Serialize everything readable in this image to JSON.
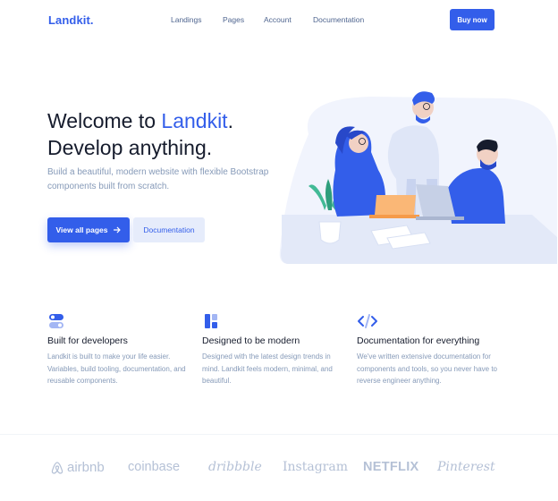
{
  "nav": {
    "logo": "Landkit.",
    "links": [
      "Landings",
      "Pages",
      "Account",
      "Documentation"
    ],
    "cta": "Buy now"
  },
  "hero": {
    "title_line1_prefix": "Welcome to ",
    "title_line1_accent": "Landkit",
    "title_line1_suffix": ".",
    "title_line2": "Develop anything.",
    "subtitle": "Build a beautiful, modern website with flexible Bootstrap components built from scratch.",
    "primary_button": "View all pages",
    "secondary_button": "Documentation"
  },
  "features": [
    {
      "icon": "toggle-icon",
      "title": "Built for developers",
      "text": "Landkit is built to make your life easier. Variables, build tooling, documentation, and reusable components."
    },
    {
      "icon": "layout-grid-icon",
      "title": "Designed to be modern",
      "text": "Designed with the latest design trends in mind. Landkit feels modern, minimal, and beautiful."
    },
    {
      "icon": "code-icon",
      "title": "Documentation for everything",
      "text": "We've written extensive documentation for components and tools, so you never have to reverse engineer anything."
    }
  ],
  "brands": [
    "airbnb",
    "coinbase",
    "dribbble",
    "Instagram",
    "NETFLIX",
    "Pinterest"
  ],
  "colors": {
    "primary": "#335eea",
    "muted": "#869ab8",
    "dark": "#161c2d",
    "logo_gray": "#b5c1d6"
  }
}
